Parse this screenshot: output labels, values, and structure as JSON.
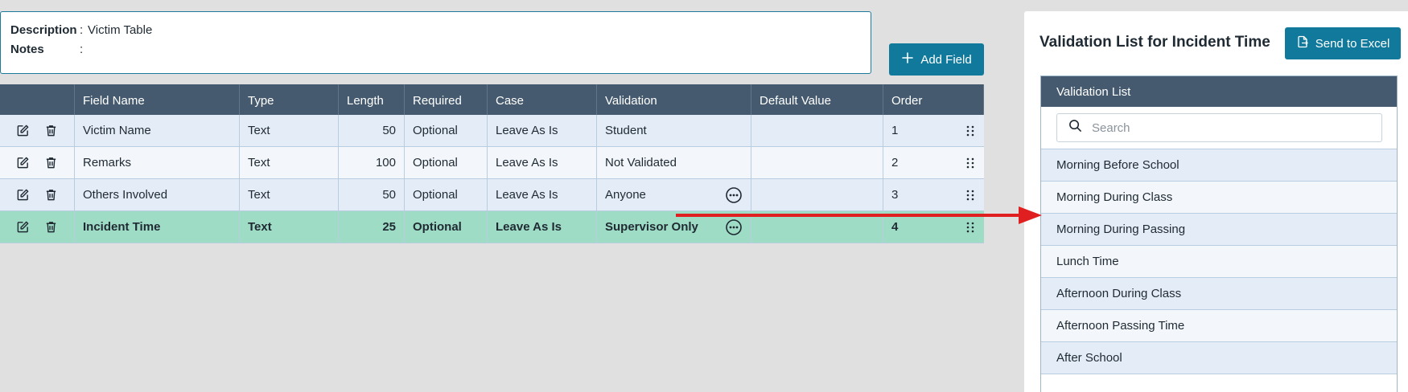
{
  "description": {
    "label": "Description",
    "value": "Victim Table"
  },
  "notes": {
    "label": "Notes",
    "value": ""
  },
  "add_field_label": "Add Field",
  "table": {
    "headers": [
      "Field Name",
      "Type",
      "Length",
      "Required",
      "Case",
      "Validation",
      "Default Value",
      "Order"
    ],
    "rows": [
      {
        "field_name": "Victim Name",
        "type": "Text",
        "length": "50",
        "required": "Optional",
        "case": "Leave As Is",
        "validation": "Student",
        "default_value": "",
        "order": "1",
        "selected": false
      },
      {
        "field_name": "Remarks",
        "type": "Text",
        "length": "100",
        "required": "Optional",
        "case": "Leave As Is",
        "validation": "Not Validated",
        "default_value": "",
        "order": "2",
        "selected": false
      },
      {
        "field_name": "Others Involved",
        "type": "Text",
        "length": "50",
        "required": "Optional",
        "case": "Leave As Is",
        "validation": "Anyone",
        "default_value": "",
        "order": "3",
        "selected": false
      },
      {
        "field_name": "Incident Time",
        "type": "Text",
        "length": "25",
        "required": "Optional",
        "case": "Leave As Is",
        "validation": "Supervisor Only",
        "default_value": "",
        "order": "4",
        "selected": true
      }
    ]
  },
  "panel": {
    "title": "Validation List for Incident Time",
    "send_label": "Send to Excel",
    "list_header": "Validation List",
    "search_placeholder": "Search",
    "items": [
      "Morning Before School",
      "Morning During Class",
      "Morning During Passing",
      "Lunch Time",
      "Afternoon During Class",
      "Afternoon Passing Time",
      "After School"
    ]
  },
  "icons": {
    "edit": "edit-icon",
    "delete": "trash-icon",
    "more": "more-horizontal-icon",
    "drag": "drag-handle-icon",
    "plus": "plus-icon",
    "excel": "export-file-icon",
    "search": "search-icon"
  },
  "colors": {
    "accent": "#117a9c",
    "header_bg": "#455a6e",
    "selected_row": "#9fdcc5",
    "arrow": "#e02020"
  }
}
